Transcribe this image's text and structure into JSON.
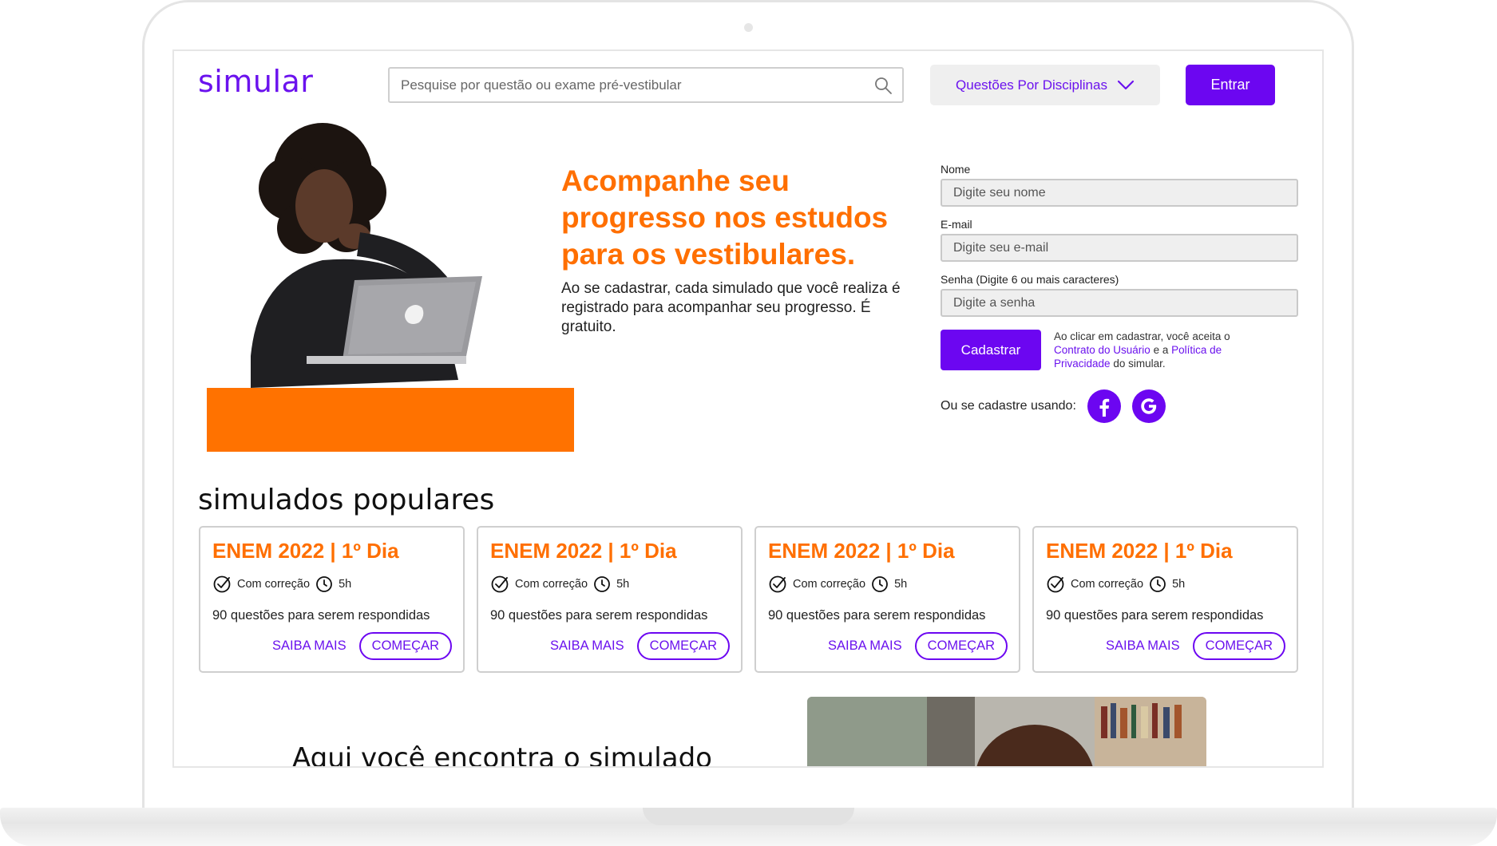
{
  "header": {
    "logo": "simular",
    "search_placeholder": "Pesquise por questão ou exame pré-vestibular",
    "disciplines_label": "Questões Por Disciplinas",
    "enter_label": "Entrar"
  },
  "hero": {
    "title": "Acompanhe seu progresso nos estudos para os vestibulares.",
    "subtitle": "Ao se cadastrar, cada simulado que você realiza é registrado para acompanhar seu progresso. É gratuito."
  },
  "form": {
    "name_label": "Nome",
    "name_placeholder": "Digite seu nome",
    "email_label": "E-mail",
    "email_placeholder": "Digite seu e-mail",
    "password_label": "Senha (Digite 6 ou mais caracteres)",
    "password_placeholder": "Digite a senha",
    "signup_label": "Cadastrar",
    "terms_prefix": "Ao clicar em cadastrar, você aceita o",
    "terms_link1": "Contrato do Usuário",
    "terms_and": "e a",
    "terms_link2": "Política de Privacidade",
    "terms_suffix": "do simular.",
    "social_label": "Ou se cadastre usando:"
  },
  "popular": {
    "title": "simulados populares",
    "cards": [
      {
        "title": "ENEM 2022 | 1º Dia",
        "correction": "Com correção",
        "duration": "5h",
        "description": "90 questões para serem respondidas",
        "more": "SAIBA MAIS",
        "start": "COMEÇAR"
      },
      {
        "title": "ENEM 2022 | 1º Dia",
        "correction": "Com correção",
        "duration": "5h",
        "description": "90 questões para serem respondidas",
        "more": "SAIBA MAIS",
        "start": "COMEÇAR"
      },
      {
        "title": "ENEM 2022 | 1º Dia",
        "correction": "Com correção",
        "duration": "5h",
        "description": "90 questões para serem respondidas",
        "more": "SAIBA MAIS",
        "start": "COMEÇAR"
      },
      {
        "title": "ENEM 2022 | 1º Dia",
        "correction": "Com correção",
        "duration": "5h",
        "description": "90 questões para serem respondidas",
        "more": "SAIBA MAIS",
        "start": "COMEÇAR"
      }
    ]
  },
  "bottom": {
    "heading": "Aqui você encontra o simulado"
  },
  "colors": {
    "brand_purple": "#6c06f1",
    "accent_orange": "#ff7200"
  }
}
